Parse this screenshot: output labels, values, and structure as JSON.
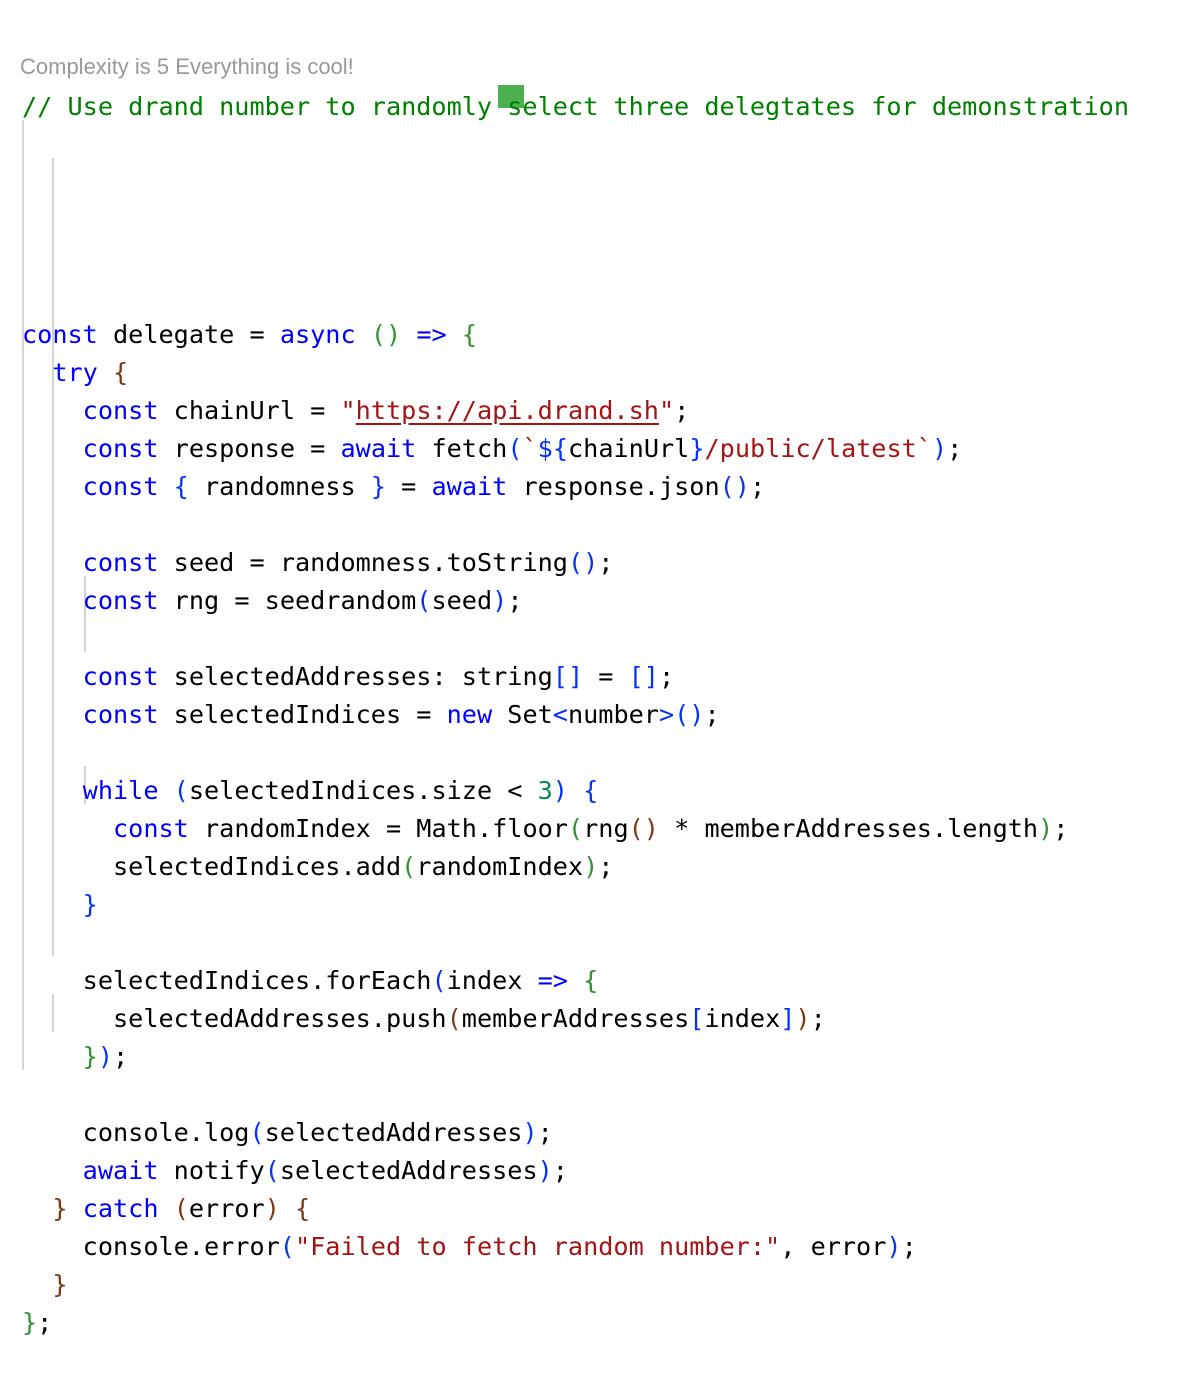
{
  "comment_line": "// Use drand number to randomly select three delegtates for demonstration",
  "complexity_hint": "Complexity is 5 Everything is cool!",
  "complexity_indicator_color": "#4caf50",
  "code_lines": [
    [
      [
        "k",
        "const"
      ],
      [
        "t",
        " delegate = "
      ],
      [
        "k",
        "async"
      ],
      [
        "t",
        " "
      ],
      [
        "b0",
        "()"
      ],
      [
        "t",
        " "
      ],
      [
        "k",
        "=>"
      ],
      [
        "t",
        " "
      ],
      [
        "b0",
        "{"
      ]
    ],
    [
      [
        "t",
        "  "
      ],
      [
        "k",
        "try"
      ],
      [
        "t",
        " "
      ],
      [
        "b1",
        "{"
      ]
    ],
    [
      [
        "t",
        "    "
      ],
      [
        "k",
        "const"
      ],
      [
        "t",
        " chainUrl = "
      ],
      [
        "s",
        "\""
      ],
      [
        "s u",
        "https://api.drand.sh"
      ],
      [
        "s",
        "\""
      ],
      [
        "t",
        ";"
      ]
    ],
    [
      [
        "t",
        "    "
      ],
      [
        "k",
        "const"
      ],
      [
        "t",
        " response = "
      ],
      [
        "k",
        "await"
      ],
      [
        "t",
        " fetch"
      ],
      [
        "b2",
        "("
      ],
      [
        "s",
        "`"
      ],
      [
        "b2",
        "${"
      ],
      [
        "t",
        "chainUrl"
      ],
      [
        "b2",
        "}"
      ],
      [
        "s",
        "/public/latest`"
      ],
      [
        "b2",
        ")"
      ],
      [
        "t",
        ";"
      ]
    ],
    [
      [
        "t",
        "    "
      ],
      [
        "k",
        "const"
      ],
      [
        "t",
        " "
      ],
      [
        "b2",
        "{"
      ],
      [
        "t",
        " randomness "
      ],
      [
        "b2",
        "}"
      ],
      [
        "t",
        " = "
      ],
      [
        "k",
        "await"
      ],
      [
        "t",
        " response.json"
      ],
      [
        "b2",
        "()"
      ],
      [
        "t",
        ";"
      ]
    ],
    [],
    [
      [
        "t",
        "    "
      ],
      [
        "k",
        "const"
      ],
      [
        "t",
        " seed = randomness.toString"
      ],
      [
        "b2",
        "()"
      ],
      [
        "t",
        ";"
      ]
    ],
    [
      [
        "t",
        "    "
      ],
      [
        "k",
        "const"
      ],
      [
        "t",
        " rng = seedrandom"
      ],
      [
        "b2",
        "("
      ],
      [
        "t",
        "seed"
      ],
      [
        "b2",
        ")"
      ],
      [
        "t",
        ";"
      ]
    ],
    [],
    [
      [
        "t",
        "    "
      ],
      [
        "k",
        "const"
      ],
      [
        "t",
        " selectedAddresses: string"
      ],
      [
        "b2",
        "[]"
      ],
      [
        "t",
        " = "
      ],
      [
        "b2",
        "[]"
      ],
      [
        "t",
        ";"
      ]
    ],
    [
      [
        "t",
        "    "
      ],
      [
        "k",
        "const"
      ],
      [
        "t",
        " selectedIndices = "
      ],
      [
        "k",
        "new"
      ],
      [
        "t",
        " Set"
      ],
      [
        "b2",
        "<"
      ],
      [
        "t",
        "number"
      ],
      [
        "b2",
        ">"
      ],
      [
        "b2",
        "()"
      ],
      [
        "t",
        ";"
      ]
    ],
    [],
    [
      [
        "t",
        "    "
      ],
      [
        "k",
        "while"
      ],
      [
        "t",
        " "
      ],
      [
        "b2",
        "("
      ],
      [
        "t",
        "selectedIndices.size < "
      ],
      [
        "n",
        "3"
      ],
      [
        "b2",
        ")"
      ],
      [
        "t",
        " "
      ],
      [
        "b2",
        "{"
      ]
    ],
    [
      [
        "t",
        "      "
      ],
      [
        "k",
        "const"
      ],
      [
        "t",
        " randomIndex = Math.floor"
      ],
      [
        "b0",
        "("
      ],
      [
        "t",
        "rng"
      ],
      [
        "b1",
        "()"
      ],
      [
        "t",
        " * memberAddresses.length"
      ],
      [
        "b0",
        ")"
      ],
      [
        "t",
        ";"
      ]
    ],
    [
      [
        "t",
        "      selectedIndices.add"
      ],
      [
        "b0",
        "("
      ],
      [
        "t",
        "randomIndex"
      ],
      [
        "b0",
        ")"
      ],
      [
        "t",
        ";"
      ]
    ],
    [
      [
        "t",
        "    "
      ],
      [
        "b2",
        "}"
      ]
    ],
    [],
    [
      [
        "t",
        "    selectedIndices.forEach"
      ],
      [
        "b2",
        "("
      ],
      [
        "t",
        "index "
      ],
      [
        "k",
        "=>"
      ],
      [
        "t",
        " "
      ],
      [
        "b0",
        "{"
      ]
    ],
    [
      [
        "t",
        "      selectedAddresses.push"
      ],
      [
        "b1",
        "("
      ],
      [
        "t",
        "memberAddresses"
      ],
      [
        "b2",
        "["
      ],
      [
        "t",
        "index"
      ],
      [
        "b2",
        "]"
      ],
      [
        "b1",
        ")"
      ],
      [
        "t",
        ";"
      ]
    ],
    [
      [
        "t",
        "    "
      ],
      [
        "b0",
        "}"
      ],
      [
        "b2",
        ")"
      ],
      [
        "t",
        ";"
      ]
    ],
    [],
    [
      [
        "t",
        "    console.log"
      ],
      [
        "b2",
        "("
      ],
      [
        "t",
        "selectedAddresses"
      ],
      [
        "b2",
        ")"
      ],
      [
        "t",
        ";"
      ]
    ],
    [
      [
        "t",
        "    "
      ],
      [
        "k",
        "await"
      ],
      [
        "t",
        " notify"
      ],
      [
        "b2",
        "("
      ],
      [
        "t",
        "selectedAddresses"
      ],
      [
        "b2",
        ")"
      ],
      [
        "t",
        ";"
      ]
    ],
    [
      [
        "t",
        "  "
      ],
      [
        "b1",
        "}"
      ],
      [
        "t",
        " "
      ],
      [
        "k",
        "catch"
      ],
      [
        "t",
        " "
      ],
      [
        "b1",
        "("
      ],
      [
        "t",
        "error"
      ],
      [
        "b1",
        ")"
      ],
      [
        "t",
        " "
      ],
      [
        "b1",
        "{"
      ]
    ],
    [
      [
        "t",
        "    console.error"
      ],
      [
        "b2",
        "("
      ],
      [
        "s",
        "\"Failed to fetch random number:\""
      ],
      [
        "t",
        ", error"
      ],
      [
        "b2",
        ")"
      ],
      [
        "t",
        ";"
      ]
    ],
    [
      [
        "t",
        "  "
      ],
      [
        "b1",
        "}"
      ]
    ],
    [
      [
        "b0",
        "}"
      ],
      [
        "t",
        ";"
      ]
    ]
  ]
}
